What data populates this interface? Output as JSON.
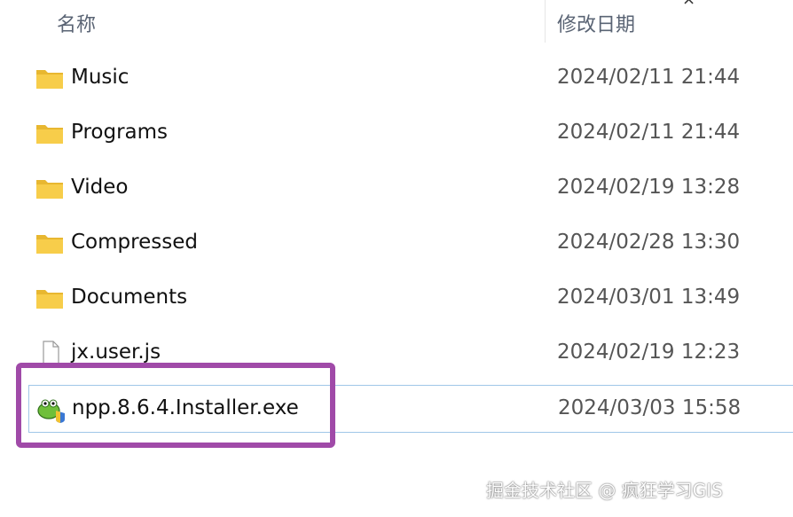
{
  "header": {
    "name_label": "名称",
    "date_label": "修改日期",
    "close_glyph": "×"
  },
  "files": [
    {
      "name": "Music",
      "date": "2024/02/11 21:44",
      "icon": "folder-icon"
    },
    {
      "name": "Programs",
      "date": "2024/02/11 21:44",
      "icon": "folder-icon"
    },
    {
      "name": "Video",
      "date": "2024/02/19 13:28",
      "icon": "folder-icon"
    },
    {
      "name": "Compressed",
      "date": "2024/02/28 13:30",
      "icon": "folder-icon"
    },
    {
      "name": "Documents",
      "date": "2024/03/01 13:49",
      "icon": "folder-icon"
    },
    {
      "name": "jx.user.js",
      "date": "2024/02/19 12:23",
      "icon": "file-icon"
    },
    {
      "name": "npp.8.6.4.Installer.exe",
      "date": "2024/03/03 15:58",
      "icon": "notepadpp-installer-icon"
    }
  ],
  "watermark": "掘金技术社区 @ 疯狂学习GIS",
  "colors": {
    "folder": "#f5c842",
    "highlight": "#a04aa8",
    "selection_border": "#9fc6e8"
  }
}
